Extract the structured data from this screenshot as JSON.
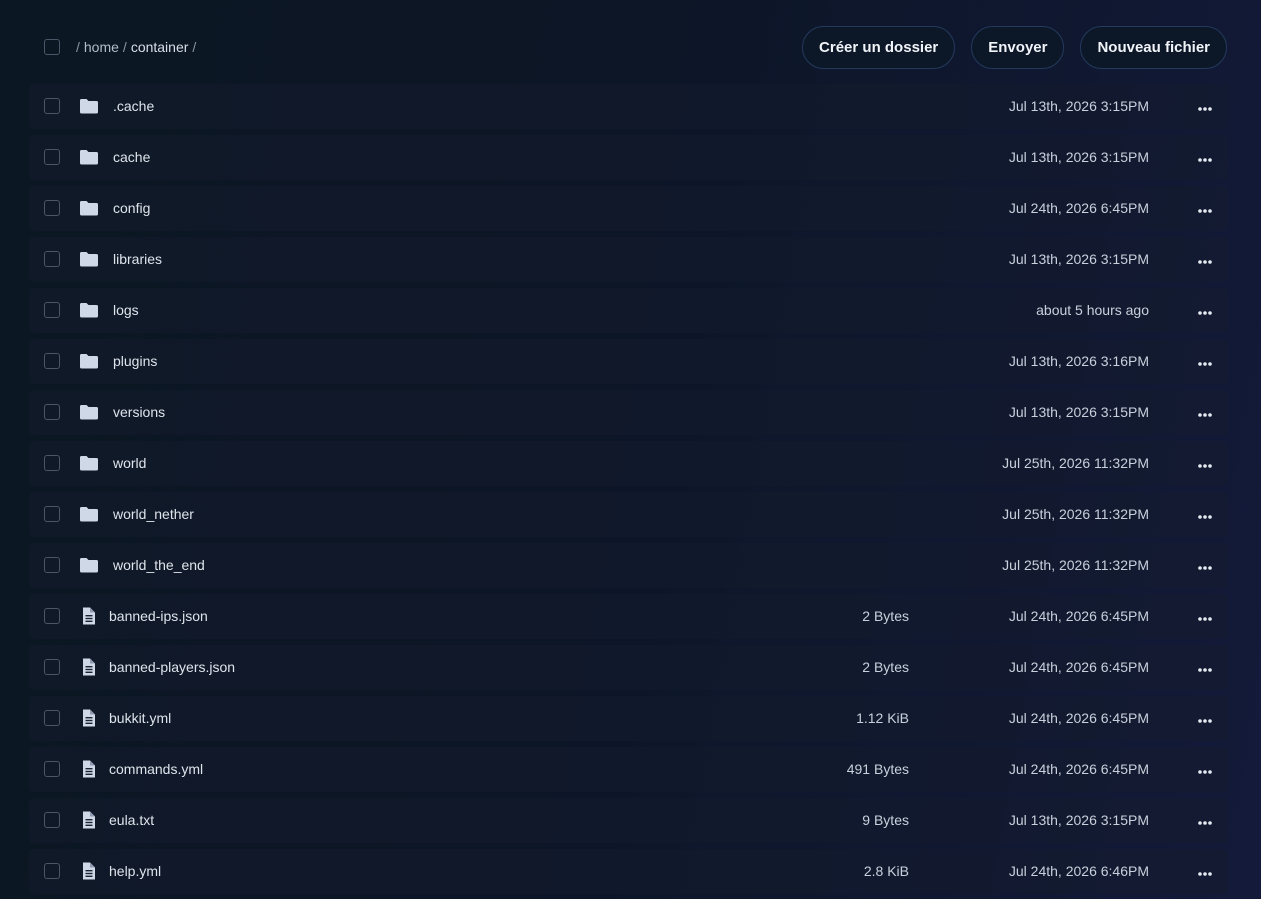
{
  "breadcrumb": {
    "separator": "/",
    "segments": [
      "home",
      "container"
    ]
  },
  "actions": {
    "create_folder": "Créer un dossier",
    "upload": "Envoyer",
    "new_file": "Nouveau fichier"
  },
  "files": [
    {
      "type": "folder",
      "name": ".cache",
      "size": "",
      "modified": "Jul 13th, 2026 3:15PM"
    },
    {
      "type": "folder",
      "name": "cache",
      "size": "",
      "modified": "Jul 13th, 2026 3:15PM"
    },
    {
      "type": "folder",
      "name": "config",
      "size": "",
      "modified": "Jul 24th, 2026 6:45PM"
    },
    {
      "type": "folder",
      "name": "libraries",
      "size": "",
      "modified": "Jul 13th, 2026 3:15PM"
    },
    {
      "type": "folder",
      "name": "logs",
      "size": "",
      "modified": "about 5 hours ago"
    },
    {
      "type": "folder",
      "name": "plugins",
      "size": "",
      "modified": "Jul 13th, 2026 3:16PM"
    },
    {
      "type": "folder",
      "name": "versions",
      "size": "",
      "modified": "Jul 13th, 2026 3:15PM"
    },
    {
      "type": "folder",
      "name": "world",
      "size": "",
      "modified": "Jul 25th, 2026 11:32PM"
    },
    {
      "type": "folder",
      "name": "world_nether",
      "size": "",
      "modified": "Jul 25th, 2026 11:32PM"
    },
    {
      "type": "folder",
      "name": "world_the_end",
      "size": "",
      "modified": "Jul 25th, 2026 11:32PM"
    },
    {
      "type": "file",
      "name": "banned-ips.json",
      "size": "2 Bytes",
      "modified": "Jul 24th, 2026 6:45PM"
    },
    {
      "type": "file",
      "name": "banned-players.json",
      "size": "2 Bytes",
      "modified": "Jul 24th, 2026 6:45PM"
    },
    {
      "type": "file",
      "name": "bukkit.yml",
      "size": "1.12 KiB",
      "modified": "Jul 24th, 2026 6:45PM"
    },
    {
      "type": "file",
      "name": "commands.yml",
      "size": "491 Bytes",
      "modified": "Jul 24th, 2026 6:45PM"
    },
    {
      "type": "file",
      "name": "eula.txt",
      "size": "9 Bytes",
      "modified": "Jul 13th, 2026 3:15PM"
    },
    {
      "type": "file",
      "name": "help.yml",
      "size": "2.8 KiB",
      "modified": "Jul 24th, 2026 6:46PM"
    }
  ]
}
